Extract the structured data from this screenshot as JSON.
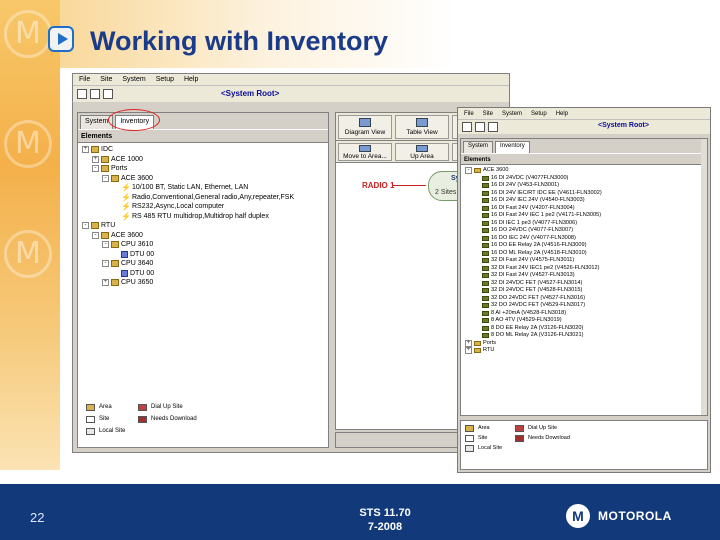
{
  "slide": {
    "title": "Working with Inventory",
    "page_number": "22",
    "footer_line1": "STS 11.70",
    "footer_line2": "7-2008",
    "brand": "MOTOROLA",
    "brand_mark": "M"
  },
  "win1": {
    "menu": [
      "File",
      "Site",
      "System",
      "Setup",
      "Help"
    ],
    "root_label": "<System Root>",
    "tabs": [
      "System",
      "Inventory"
    ],
    "pane_header": "Elements",
    "tree": [
      {
        "label": "IDC",
        "depth": 0,
        "exp": "+",
        "icon": "folder"
      },
      {
        "label": "ACE 1000",
        "depth": 1,
        "exp": "+",
        "icon": "folder"
      },
      {
        "label": "Ports",
        "depth": 1,
        "exp": "-",
        "icon": "folder"
      },
      {
        "label": "ACE 3600",
        "depth": 2,
        "exp": "-",
        "icon": "folder"
      },
      {
        "label": "10/100 BT, Static LAN, Ethernet, LAN",
        "depth": 3,
        "exp": "",
        "icon": "link"
      },
      {
        "label": "Radio,Conventional,General radio,Any,repeater,FSK",
        "depth": 3,
        "exp": "",
        "icon": "link"
      },
      {
        "label": "RS232,Async,Local computer",
        "depth": 3,
        "exp": "",
        "icon": "link"
      },
      {
        "label": "RS 485 RTU multidrop,Multidrop half duplex",
        "depth": 3,
        "exp": "",
        "icon": "link"
      },
      {
        "label": "RTU",
        "depth": 0,
        "exp": "-",
        "icon": "folder"
      },
      {
        "label": "ACE 3600",
        "depth": 1,
        "exp": "-",
        "icon": "folder"
      },
      {
        "label": "CPU 3610",
        "depth": 2,
        "exp": "-",
        "icon": "folder"
      },
      {
        "label": "DTU 00",
        "depth": 3,
        "exp": "",
        "icon": "device"
      },
      {
        "label": "CPU 3640",
        "depth": 2,
        "exp": "-",
        "icon": "folder"
      },
      {
        "label": "DTU 00",
        "depth": 3,
        "exp": "",
        "icon": "device"
      },
      {
        "label": "CPU 3650",
        "depth": 2,
        "exp": "+",
        "icon": "folder"
      }
    ],
    "legend": [
      {
        "label": "Area",
        "color": "#d8b24a"
      },
      {
        "label": "Site",
        "color": "#ffffff"
      },
      {
        "label": "Local Site",
        "color": "#e8e8e8"
      },
      {
        "label": "Dial Up Site",
        "color": "#c04040"
      },
      {
        "label": "Needs Download",
        "color": "#a03030"
      }
    ],
    "right_buttons": [
      "Diagram View",
      "Table View",
      "Line"
    ],
    "right_buttons2": [
      "Move to Area...",
      "Up Area",
      "Lin"
    ],
    "radio_node": "RADIO 1",
    "sydney_node": "Sydney",
    "sydney_sub": "2 Sites"
  },
  "win2": {
    "menu": [
      "File",
      "Site",
      "System",
      "Setup",
      "Help"
    ],
    "root_label": "<System Root>",
    "tabs": [
      "System",
      "Inventory"
    ],
    "pane_header": "Elements",
    "tree": [
      {
        "label": "ACE 3600",
        "depth": 0,
        "exp": "-",
        "icon": "folder",
        "hl": false
      },
      {
        "label": "16 DI 24VDC (V4077FLN3000)",
        "depth": 1,
        "icon": "device"
      },
      {
        "label": "16 DI 24V (V453-FLN3001)",
        "depth": 1,
        "icon": "device"
      },
      {
        "label": "16 DI 24V IEC/RT IDC EE (V4611-FLN3002)",
        "depth": 1,
        "icon": "device"
      },
      {
        "label": "16 DI 24V IEC 24V (V4540-FLN3003)",
        "depth": 1,
        "icon": "device"
      },
      {
        "label": "16 DI Fast 24V (V4207-FLN3004)",
        "depth": 1,
        "icon": "device"
      },
      {
        "label": "16 DI Fast 24V IEC 1 pe2 (V4171-FLN3005)",
        "depth": 1,
        "icon": "device"
      },
      {
        "label": "16 DI IEC 1 pe3 (V4077-FLN3006)",
        "depth": 1,
        "icon": "device"
      },
      {
        "label": "16 DO 24VDC (V4077-FLN3007)",
        "depth": 1,
        "icon": "device"
      },
      {
        "label": "16 DO IEC 24V (V4077-FLN3008)",
        "depth": 1,
        "icon": "device"
      },
      {
        "label": "16 DO EE Relay 2A (V4516-FLN3009)",
        "depth": 1,
        "icon": "device"
      },
      {
        "label": "16 DO ML Relay 2A (V4518-FLN3010)",
        "depth": 1,
        "icon": "device"
      },
      {
        "label": "32 DI Fast 24V (V4575-FLN3011)",
        "depth": 1,
        "icon": "device"
      },
      {
        "label": "32 DI Fast 24V IEC1 pe2 (V4526-FLN3012)",
        "depth": 1,
        "icon": "device"
      },
      {
        "label": "32 DI Fast 24V (V4527-FLN3013)",
        "depth": 1,
        "icon": "device"
      },
      {
        "label": "32 DI 24VDC FET (V4527-FLN3014)",
        "depth": 1,
        "icon": "device"
      },
      {
        "label": "32 DI 24VDC FET (V4528-FLN3015)",
        "depth": 1,
        "icon": "device"
      },
      {
        "label": "32 DO 24VDC FET (V4527-FLN3016)",
        "depth": 1,
        "icon": "device"
      },
      {
        "label": "32 DO 24VDC FET (V4529-FLN3017)",
        "depth": 1,
        "icon": "device"
      },
      {
        "label": "8 AI +20mA (V4528-FLN3018)",
        "depth": 1,
        "icon": "device"
      },
      {
        "label": "8 AO 4TV (V4529-FLN3019)",
        "depth": 1,
        "icon": "device"
      },
      {
        "label": "8 DO EE Relay 2A (V3126-FLN3020)",
        "depth": 1,
        "icon": "device"
      },
      {
        "label": "8 DO ML Relay 2A (V3126-FLN3021)",
        "depth": 1,
        "icon": "device"
      },
      {
        "label": "Ports",
        "depth": 0,
        "exp": "+",
        "icon": "folder"
      },
      {
        "label": "RTU",
        "depth": 0,
        "exp": "+",
        "icon": "folder"
      }
    ],
    "legend": [
      {
        "label": "Area",
        "color": "#d8b24a"
      },
      {
        "label": "Site",
        "color": "#ffffff"
      },
      {
        "label": "Local Site",
        "color": "#e8e8e8"
      },
      {
        "label": "Dial Up Site",
        "color": "#c04040"
      },
      {
        "label": "Needs Download",
        "color": "#a03030"
      }
    ]
  }
}
